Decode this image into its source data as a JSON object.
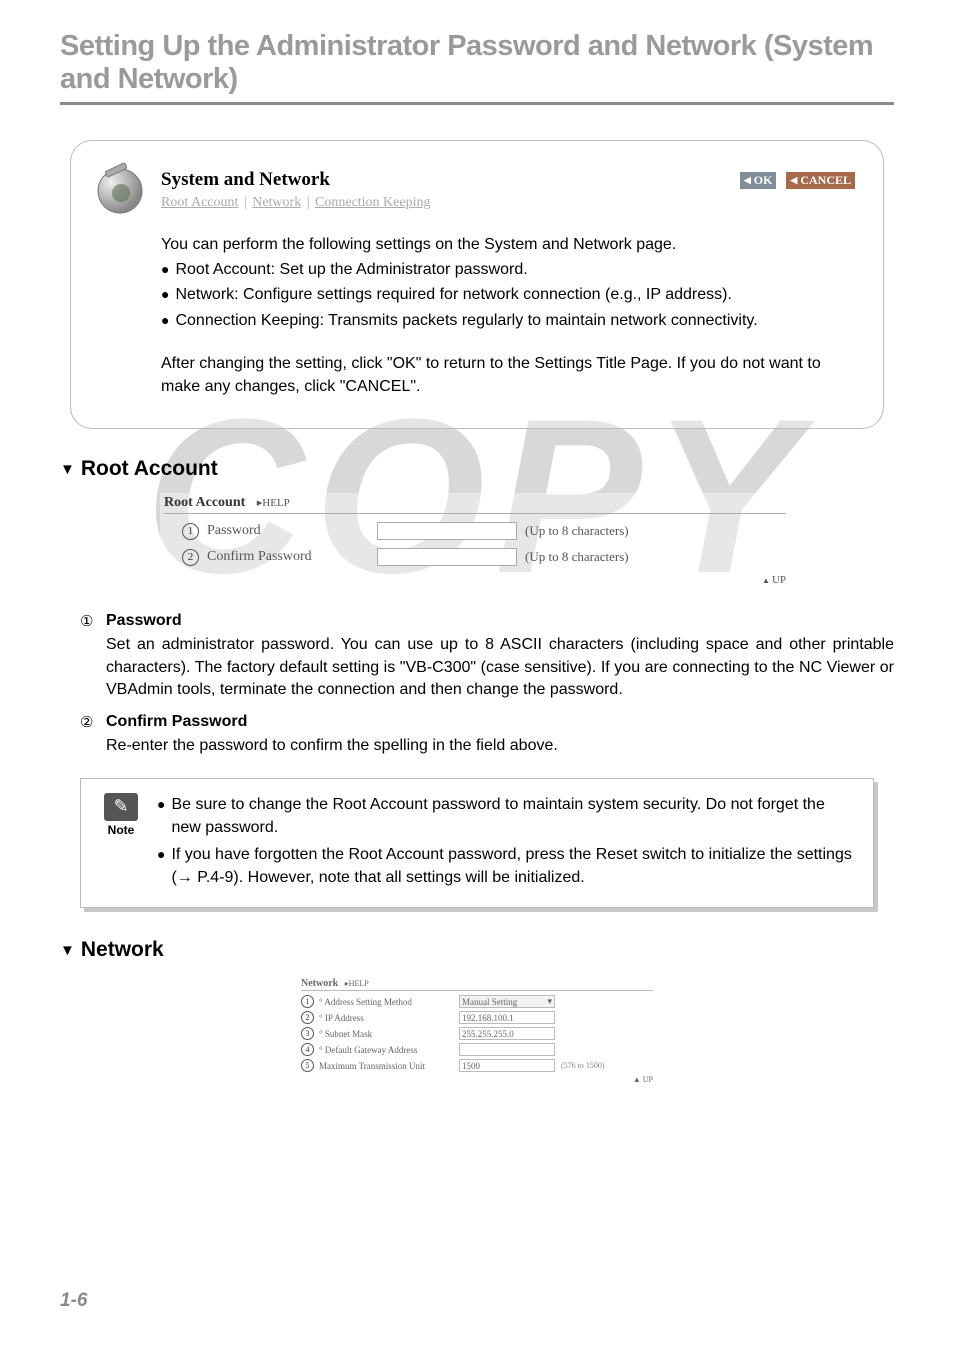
{
  "watermark": "COPY",
  "page_title": "Setting Up the Administrator Password and Network (System and Network)",
  "panel": {
    "title": "System and Network",
    "ok": "OK",
    "cancel": "CANCEL",
    "links": {
      "root": "Root Account",
      "network": "Network",
      "conn": "Connection Keeping"
    },
    "intro": "You can perform the following settings on the System and Network page.",
    "b1": "Root Account: Set up the Administrator password.",
    "b2": "Network: Configure settings required for network connection (e.g., IP address).",
    "b3": "Connection Keeping: Transmits packets regularly to maintain network connectivity.",
    "after": "After changing the setting, click \"OK\" to return to the Settings Title Page. If you do not want to make any changes, click \"CANCEL\"."
  },
  "root_section": {
    "heading": "Root Account",
    "shot": {
      "title": "Root Account",
      "help": "▸HELP",
      "row1_label": "Password",
      "row1_hint": "(Up to 8 characters)",
      "row2_label": "Confirm Password",
      "row2_hint": "(Up to 8 characters)",
      "up": "UP"
    },
    "items": [
      {
        "num": "①",
        "title": "Password",
        "text": "Set an administrator password. You can use up to 8 ASCII characters (including space and other printable characters). The factory default setting is \"VB-C300\" (case sensitive). If you are connecting to the NC Viewer or VBAdmin tools, terminate the connection and then change the password."
      },
      {
        "num": "②",
        "title": "Confirm Password",
        "text": "Re-enter the password to confirm the spelling in the field above."
      }
    ]
  },
  "note": {
    "label": "Note",
    "n1": "Be sure to change the Root Account password to maintain system security. Do not forget the new password.",
    "n2": "If you have forgotten the Root Account password, press the Reset switch to initialize the settings (→ P.4-9). However, note that all settings will be initialized."
  },
  "network_section": {
    "heading": "Network",
    "shot": {
      "title": "Network",
      "help": "▸HELP",
      "rows": [
        {
          "n": "1",
          "label": "° Address Setting Method",
          "type": "select",
          "value": "Manual Setting"
        },
        {
          "n": "2",
          "label": "° IP Address",
          "type": "input",
          "value": "192.168.100.1"
        },
        {
          "n": "3",
          "label": "° Subnet Mask",
          "type": "input",
          "value": "255.255.255.0"
        },
        {
          "n": "4",
          "label": "° Default Gateway Address",
          "type": "input",
          "value": ""
        },
        {
          "n": "5",
          "label": "Maximum Transmission Unit",
          "type": "input",
          "value": "1500",
          "hint": "(576 to 1500)"
        }
      ],
      "up": "UP"
    }
  },
  "page_number": "1-6"
}
